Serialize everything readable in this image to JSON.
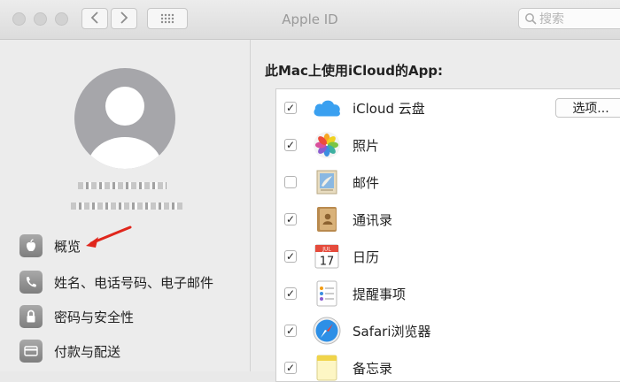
{
  "window": {
    "title": "Apple ID",
    "search_placeholder": "搜索"
  },
  "sidebar": {
    "items": [
      {
        "label": "概览",
        "icon": "apple-icon"
      },
      {
        "label": "姓名、电话号码、电子邮件",
        "icon": "phone-icon"
      },
      {
        "label": "密码与安全性",
        "icon": "lock-icon"
      },
      {
        "label": "付款与配送",
        "icon": "card-icon"
      }
    ]
  },
  "main": {
    "section_title": "此Mac上使用iCloud的App:",
    "apps": [
      {
        "label": "iCloud 云盘",
        "checked": true,
        "icon": "icloud-drive-icon",
        "option": "选项..."
      },
      {
        "label": "照片",
        "checked": true,
        "icon": "photos-icon"
      },
      {
        "label": "邮件",
        "checked": false,
        "icon": "mail-icon"
      },
      {
        "label": "通讯录",
        "checked": true,
        "icon": "contacts-icon"
      },
      {
        "label": "日历",
        "checked": true,
        "icon": "calendar-icon",
        "icon_day": "17",
        "icon_month": "JUL"
      },
      {
        "label": "提醒事项",
        "checked": true,
        "icon": "reminders-icon"
      },
      {
        "label": "Safari浏览器",
        "checked": true,
        "icon": "safari-icon"
      },
      {
        "label": "备忘录",
        "checked": true,
        "icon": "notes-icon"
      }
    ]
  },
  "annotation": {
    "arrow_color": "#e0261c"
  }
}
